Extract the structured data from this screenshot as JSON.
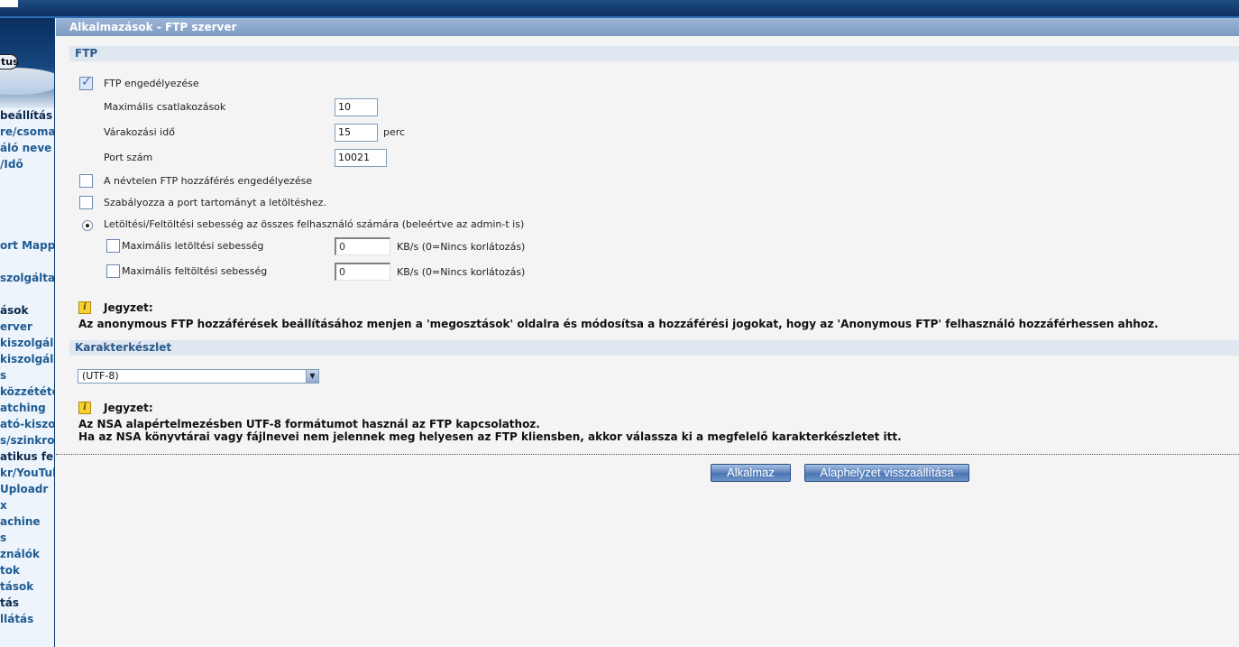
{
  "sidebar": {
    "status_label": "tus",
    "items": [
      "beállítás",
      "re/csoma",
      "áló neve",
      "/Idő",
      "ort Mappi",
      "szolgáltat",
      "ások",
      "erver",
      "kiszolgáló",
      "kiszolgálo",
      "s",
      "közzététe",
      "atching",
      "ató-kiszol",
      "s/szinkro",
      "atikus felt",
      "kr/YouTub",
      "Uploadr",
      "x",
      "achine",
      "s",
      "ználók",
      "tok",
      "tások",
      "tás",
      "llátás"
    ]
  },
  "header": {
    "title": "Alkalmazások - FTP szerver"
  },
  "ftp": {
    "section_title": "FTP",
    "enable_label": "FTP engedélyezése",
    "enable_checked": true,
    "max_conn_label": "Maximális csatlakozások",
    "max_conn_value": "10",
    "wait_label": "Várakozási idő",
    "wait_value": "15",
    "wait_unit": "perc",
    "port_label": "Port szám",
    "port_value": "10021",
    "anon_label": "A névtelen FTP hozzáférés engedélyezése",
    "anon_checked": false,
    "port_range_label": "Szabályozza a port tartományt a letöltéshez.",
    "port_range_checked": false,
    "speed_all_label": "Letöltési/Feltöltési sebesség az összes felhasználó számára (beleértve az admin-t is)",
    "speed_all_selected": true,
    "max_down_label": "Maximális letöltési sebesség",
    "max_down_value": "0",
    "max_down_unit": "KB/s (0=Nincs korlátozás)",
    "max_up_label": "Maximális feltöltési sebesség",
    "max_up_value": "0",
    "max_up_unit": "KB/s (0=Nincs korlátozás)",
    "note_title": "Jegyzet:",
    "note_text": "Az anonymous FTP hozzáférések beállításához menjen a 'megosztások' oldalra és módosítsa a hozzáférési jogokat, hogy az 'Anonymous FTP' felhasználó hozzáférhessen ahhoz."
  },
  "charset": {
    "section_title": "Karakterkészlet",
    "selected": "(UTF-8)",
    "note_title": "Jegyzet:",
    "note_line1": "Az NSA alapértelmezésben UTF-8 formátumot használ az FTP kapcsolathoz.",
    "note_line2": "Ha az NSA könyvtárai vagy fájlnevei nem jelennek meg helyesen az FTP kliensben, akkor válassza ki a megfelelő karakterkészletet itt."
  },
  "actions": {
    "apply_label": "Alkalmaz",
    "reset_label": "Alaphelyzet visszaállítása"
  },
  "colors": {
    "top_bar": "#0d2f5c",
    "title_bar": "#7e9cc4",
    "section_head_bg": "#dfe7f1",
    "section_head_text": "#2c5a8e",
    "sidebar_link": "#1d5b93",
    "button": "#4a73b0"
  },
  "icons": {
    "note": "info-note-icon",
    "dropdown": "chevron-down-icon",
    "checkbox_checked": "checkmark-icon"
  }
}
